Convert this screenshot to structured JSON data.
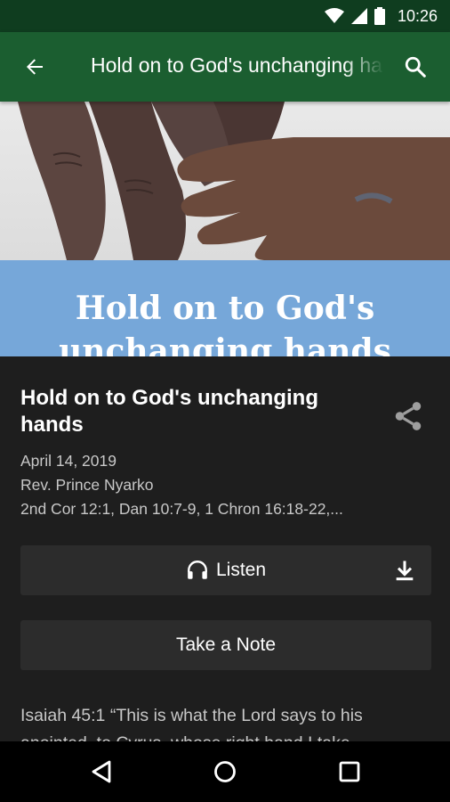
{
  "status_bar": {
    "time": "10:26"
  },
  "app_bar": {
    "title": "Hold on to God's unchanging hands"
  },
  "hero": {
    "line1": "Hold on to God's",
    "line2": "unchanging hands"
  },
  "sermon": {
    "title": "Hold on to God's unchanging hands",
    "date": "April 14, 2019",
    "speaker": "Rev. Prince Nyarko",
    "scripture": "2nd Cor 12:1, Dan 10:7-9, 1 Chron 16:18-22,..."
  },
  "buttons": {
    "listen_label": "Listen",
    "note_label": "Take a Note"
  },
  "body": {
    "line1": "Isaiah 45:1 “This is what the Lord says to his",
    "line2": "anointed, to Cyrus, whose right hand I take"
  },
  "icons": {
    "wifi": "wifi-icon",
    "signal": "signal-icon",
    "battery": "battery-icon",
    "back": "arrow-back-icon",
    "search": "search-icon",
    "share": "share-icon",
    "headphones": "headphones-icon",
    "download": "download-icon",
    "nav_back": "nav-back-icon",
    "nav_home": "nav-home-icon",
    "nav_recents": "nav-recents-icon"
  },
  "colors": {
    "status_bar": "#0f3d1f",
    "app_bar": "#1b5e30",
    "hero_band": "#76a7d9",
    "sheet": "#1e1e1e"
  }
}
